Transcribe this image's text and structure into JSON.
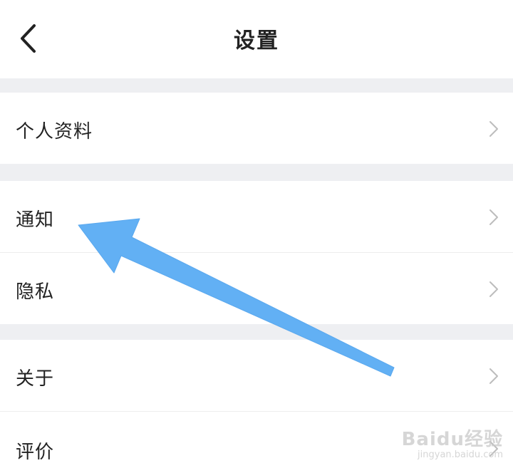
{
  "header": {
    "title": "设置",
    "back_icon": "chevron-left-icon"
  },
  "rows": [
    {
      "label": "个人资料",
      "icon": "chevron-right-icon"
    },
    {
      "label": "通知",
      "icon": "chevron-right-icon"
    },
    {
      "label": "隐私",
      "icon": "chevron-right-icon"
    },
    {
      "label": "关于",
      "icon": "chevron-right-icon"
    },
    {
      "label": "评价",
      "icon": "chevron-right-icon"
    }
  ],
  "annotation": {
    "arrow_color": "#62b0f4",
    "points_to": "通知"
  },
  "watermark": {
    "logo": "Baidu经验",
    "url": "jingyan.baidu.com"
  },
  "colors": {
    "background": "#ffffff",
    "section_gap": "#eeeff2",
    "text": "#222222",
    "chevron": "#bdbdbd"
  }
}
